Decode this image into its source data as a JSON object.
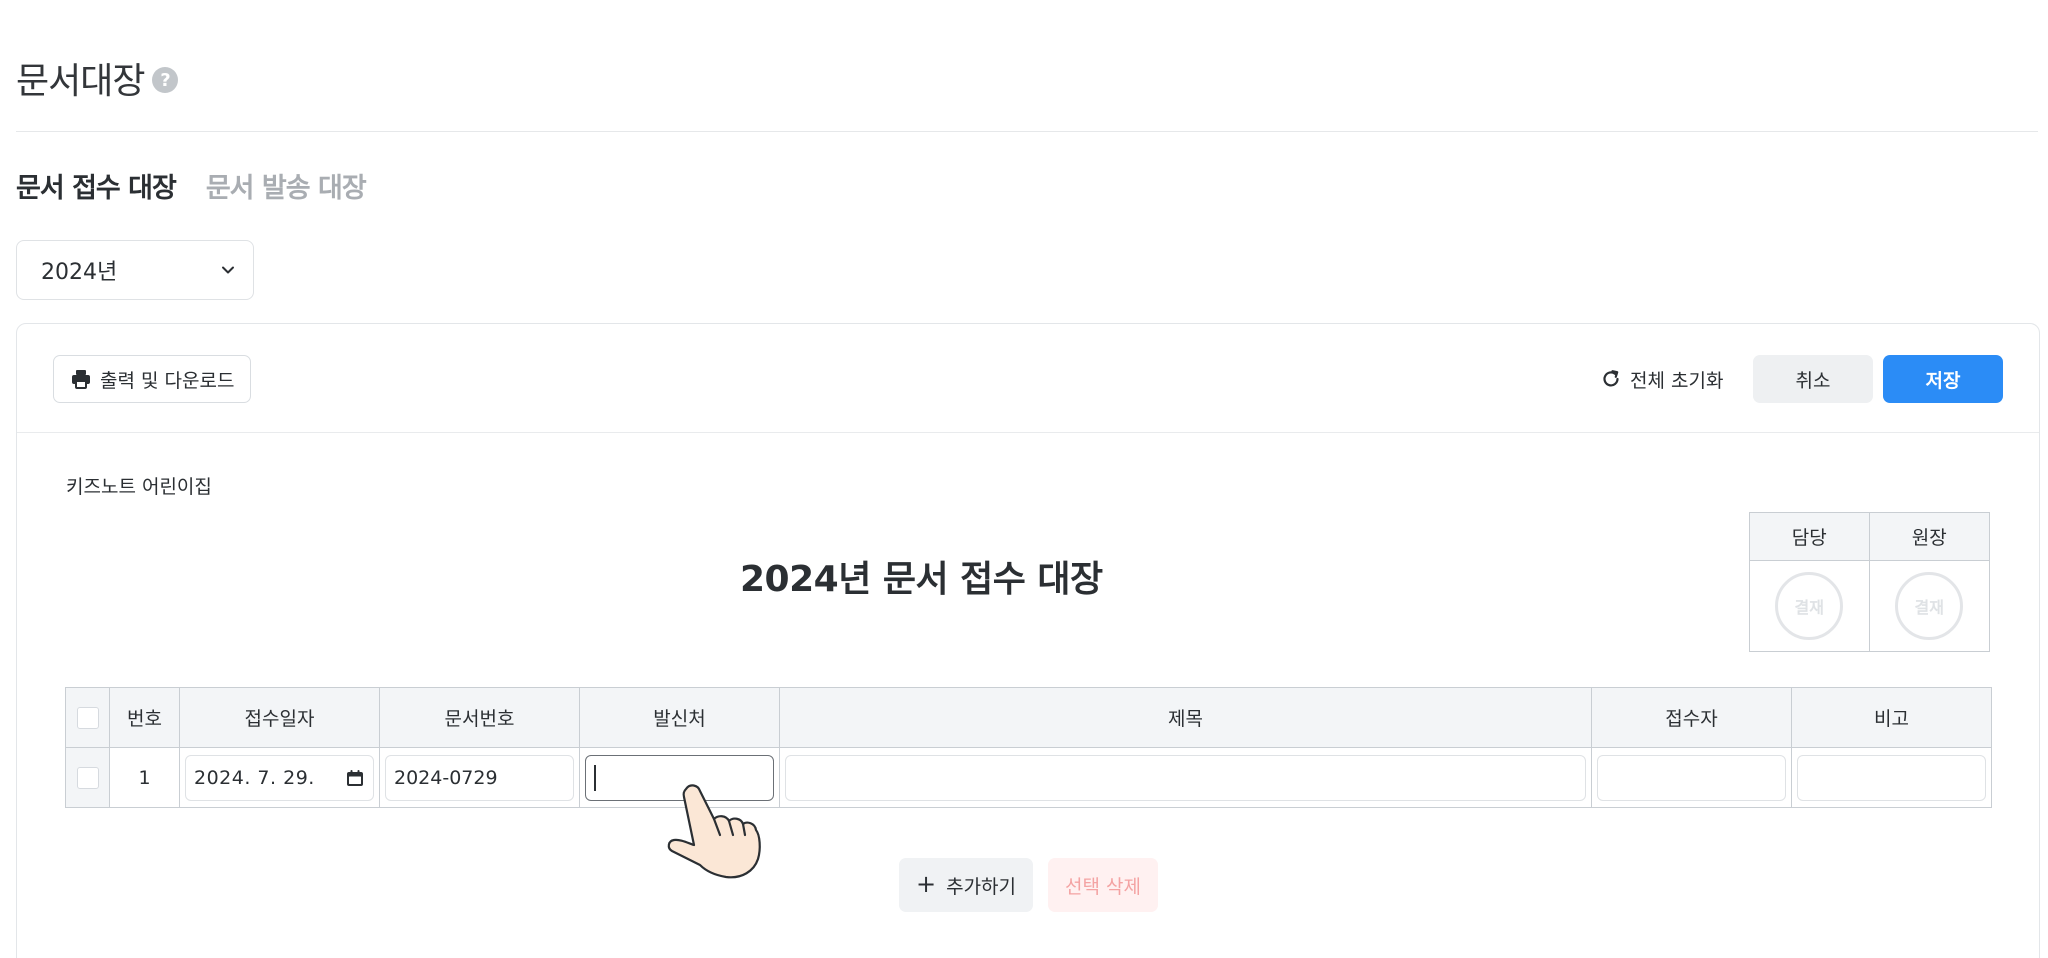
{
  "header": {
    "title": "문서대장",
    "help_glyph": "?"
  },
  "tabs": [
    {
      "label": "문서 접수 대장",
      "active": true
    },
    {
      "label": "문서 발송 대장",
      "active": false
    }
  ],
  "year_select": {
    "value": "2024년"
  },
  "toolbar": {
    "print_label": "출력 및 다운로드",
    "reset_label": "전체 초기화",
    "cancel_label": "취소",
    "save_label": "저장"
  },
  "document": {
    "org_name": "키즈노트 어린이집",
    "title": "2024년 문서 접수 대장"
  },
  "approval": {
    "headers": [
      "담당",
      "원장"
    ],
    "stamp_label": "결재"
  },
  "table": {
    "headers": [
      "번호",
      "접수일자",
      "문서번호",
      "발신처",
      "제목",
      "접수자",
      "비고"
    ],
    "rows": [
      {
        "no": "1",
        "date": "2024. 7. 29.",
        "doc_no": "2024-0729",
        "sender": "",
        "subject": "",
        "receiver": "",
        "note": ""
      }
    ]
  },
  "actions": {
    "add_label": "추가하기",
    "add_glyph": "+",
    "delete_label": "선택 삭제"
  },
  "colors": {
    "primary": "#2b8cf6",
    "danger_text": "#f4a3a3",
    "danger_bg": "#fff1f1",
    "muted_tab": "#a9adb2"
  },
  "icons": [
    "help-icon",
    "chevron-down-icon",
    "print-icon",
    "refresh-icon",
    "calendar-icon",
    "plus-icon",
    "hand-cursor-icon"
  ]
}
